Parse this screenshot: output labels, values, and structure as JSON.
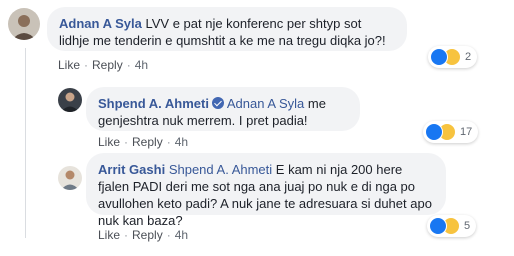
{
  "comments": [
    {
      "author": "Adnan A Syla",
      "mention": "",
      "text": "LVV e pat nje konferenc per shtyp sot lidhje me tenderin e qumshtit a ke me na tregu diqka jo?!",
      "like_label": "Like",
      "reply_label": "Reply",
      "time": "4h",
      "reaction_count": "2",
      "reaction_icons": [
        "like-icon",
        "haha-icon"
      ]
    },
    {
      "author": "Shpend A. Ahmeti",
      "verified": true,
      "mention": "Adnan A Syla",
      "text": "me genjeshtra nuk merrem. I pret padia!",
      "like_label": "Like",
      "reply_label": "Reply",
      "time": "4h",
      "reaction_count": "17",
      "reaction_icons": [
        "like-icon",
        "haha-icon"
      ]
    },
    {
      "author": "Arrit Gashi",
      "mention": "Shpend A. Ahmeti",
      "text": "E kam ni nja 200 here fjalen PADI deri me sot nga ana juaj po nuk e di nga po avullohen keto padi? A nuk jane te adresuara si duhet apo nuk kan baza?",
      "like_label": "Like",
      "reply_label": "Reply",
      "time": "4h",
      "reaction_count": "5",
      "reaction_icons": [
        "like-icon",
        "haha-icon"
      ]
    }
  ],
  "colors": {
    "link_blue": "#385898",
    "bubble_bg": "#f2f3f5",
    "like_blue": "#1877f2",
    "haha_yellow": "#f7c33f"
  }
}
